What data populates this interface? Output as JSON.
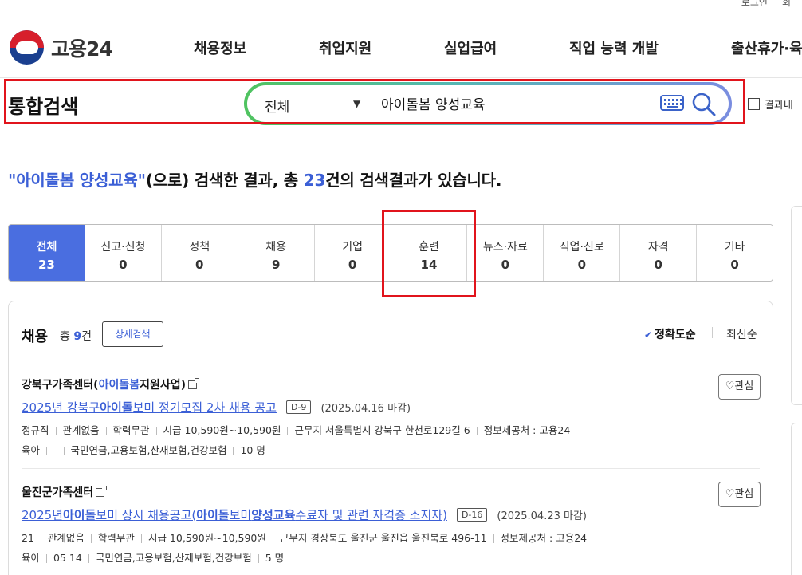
{
  "top": {
    "login": "로그인",
    "extra": "회"
  },
  "brand": {
    "name": "고용24"
  },
  "gnb": [
    "채용정보",
    "취업지원",
    "실업급여",
    "직업 능력 개발",
    "출산휴가·육"
  ],
  "search": {
    "title": "통합검색",
    "scope": "전체",
    "query": "아이돌봄 양성교육",
    "in_results": "결과내"
  },
  "result_summary": {
    "keyword": "\"아이돌봄 양성교육\"",
    "mid": "(으로) 검색한 결과, 총 ",
    "count": "23",
    "tail": "건의 검색결과가 있습니다."
  },
  "categories": [
    {
      "label": "전체",
      "count": "23",
      "active": true
    },
    {
      "label": "신고·신청",
      "count": "0"
    },
    {
      "label": "정책",
      "count": "0"
    },
    {
      "label": "채용",
      "count": "9"
    },
    {
      "label": "기업",
      "count": "0"
    },
    {
      "label": "훈련",
      "count": "14"
    },
    {
      "label": "뉴스·자료",
      "count": "0"
    },
    {
      "label": "직업·진로",
      "count": "0"
    },
    {
      "label": "자격",
      "count": "0"
    },
    {
      "label": "기타",
      "count": "0"
    }
  ],
  "section": {
    "title": "채용",
    "total_prefix": "총 ",
    "total_count": "9",
    "total_suffix": "건",
    "detail_button": "상세검색",
    "sort_accuracy": "정확도순",
    "sort_latest": "최신순",
    "favorite_label": "관심"
  },
  "items": [
    {
      "company_a": "강북구가족센터(",
      "company_hl": "아이돌봄",
      "company_b": "지원사업)",
      "title_parts": [
        {
          "t": "2025년 강북구",
          "b": false
        },
        {
          "t": "아이돌",
          "b": true
        },
        {
          "t": "보미 정기모집 2차 채용 공고",
          "b": false
        }
      ],
      "dday": "D-9",
      "deadline": "(2025.04.16 마감)",
      "meta1": [
        "정규직",
        "관계없음",
        "학력무관",
        "시급 10,590원~10,590원",
        "근무지 서울특별시 강북구 한천로129길 6",
        "정보제공처 : 고용24"
      ],
      "meta2": [
        "육아",
        "-",
        "국민연금,고용보험,산재보험,건강보험",
        "10 명"
      ]
    },
    {
      "company_a": "울진군가족센터",
      "company_hl": "",
      "company_b": "",
      "title_parts": [
        {
          "t": "2025년",
          "b": false
        },
        {
          "t": "아이돌",
          "b": true
        },
        {
          "t": "보미 상시 채용공고(",
          "b": false
        },
        {
          "t": "아이돌",
          "b": true
        },
        {
          "t": "보미",
          "b": false
        },
        {
          "t": "양성교육",
          "b": true
        },
        {
          "t": "수료자 및 관련 자격증 소지자)",
          "b": false
        }
      ],
      "dday": "D-16",
      "deadline": "(2025.04.23 마감)",
      "meta1": [
        "21",
        "관계없음",
        "학력무관",
        "시급 10,590원~10,590원",
        "근무지 경상북도 울진군 울진읍 울진북로 496-11",
        "정보제공처 : 고용24"
      ],
      "meta2": [
        "육아",
        "05 14",
        "국민연금,고용보험,산재보험,건강보험",
        "5 명"
      ]
    }
  ]
}
